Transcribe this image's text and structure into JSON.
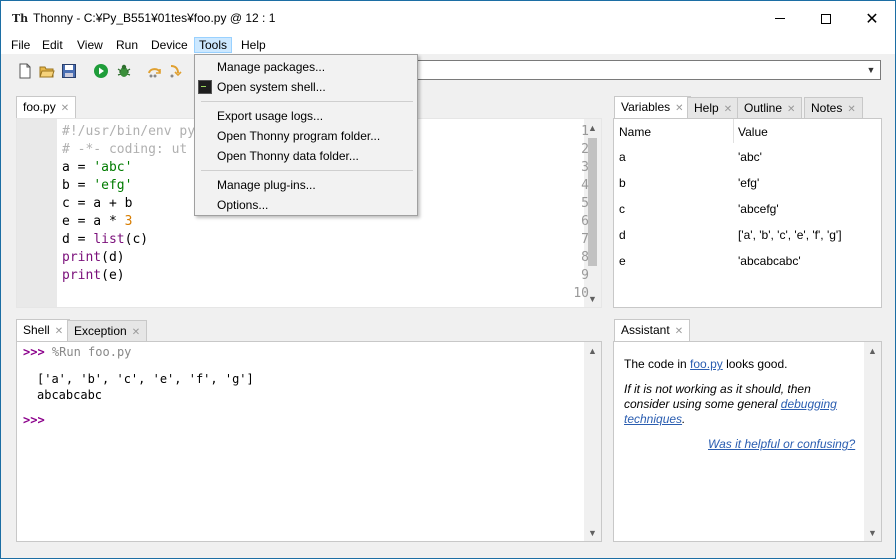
{
  "window": {
    "app_name": "Thonny",
    "path_title": "C:¥Py_B551¥01tes¥foo.py",
    "cursor": "@ 12 : 1",
    "icon_glyph": "Th"
  },
  "menubar": {
    "items": [
      "File",
      "Edit",
      "View",
      "Run",
      "Device",
      "Tools",
      "Help"
    ],
    "active": "Tools"
  },
  "toolbar": {
    "icons": [
      "new-file-icon",
      "open-file-icon",
      "save-icon",
      "run-icon",
      "debug-icon",
      "step-over-icon",
      "step-into-icon"
    ]
  },
  "tools_menu": {
    "items": [
      {
        "label": "Manage packages..."
      },
      {
        "label": "Open system shell..."
      },
      {
        "label": "Export usage logs..."
      },
      {
        "label": "Open Thonny program folder..."
      },
      {
        "label": "Open Thonny data folder..."
      },
      {
        "label": "Manage plug-ins..."
      },
      {
        "label": "Options..."
      }
    ]
  },
  "editor": {
    "tab": "foo.py",
    "line_numbers": [
      "1",
      "2",
      "3",
      "4",
      "5",
      "6",
      "7",
      "8",
      "9",
      "10"
    ],
    "lines": [
      {
        "parts": [
          {
            "t": "#!/usr/bin/env py",
            "c": "comment"
          }
        ]
      },
      {
        "parts": [
          {
            "t": "# -*- coding: ut",
            "c": "comment"
          }
        ]
      },
      {
        "parts": [
          {
            "t": "a = ",
            "c": ""
          },
          {
            "t": "'abc'",
            "c": "str"
          }
        ]
      },
      {
        "parts": [
          {
            "t": "b = ",
            "c": ""
          },
          {
            "t": "'efg'",
            "c": "str"
          }
        ]
      },
      {
        "parts": [
          {
            "t": "c = a + b",
            "c": ""
          }
        ]
      },
      {
        "parts": [
          {
            "t": "e = a * ",
            "c": ""
          },
          {
            "t": "3",
            "c": "num"
          }
        ]
      },
      {
        "parts": [
          {
            "t": "d = ",
            "c": ""
          },
          {
            "t": "list",
            "c": "kw"
          },
          {
            "t": "(c)",
            "c": ""
          }
        ]
      },
      {
        "parts": [
          {
            "t": "print",
            "c": "kw"
          },
          {
            "t": "(d)",
            "c": ""
          }
        ]
      },
      {
        "parts": [
          {
            "t": "print",
            "c": "kw"
          },
          {
            "t": "(e)",
            "c": ""
          }
        ]
      },
      {
        "parts": []
      }
    ]
  },
  "variables": {
    "tabs": [
      "Variables",
      "Help",
      "Outline",
      "Notes"
    ],
    "headers": [
      "Name",
      "Value"
    ],
    "rows": [
      {
        "name": "a",
        "value": "'abc'"
      },
      {
        "name": "b",
        "value": "'efg'"
      },
      {
        "name": "c",
        "value": "'abcefg'"
      },
      {
        "name": "d",
        "value": "['a', 'b', 'c', 'e', 'f', 'g']"
      },
      {
        "name": "e",
        "value": "'abcabcabc'"
      }
    ]
  },
  "shell": {
    "tabs": [
      "Shell",
      "Exception"
    ],
    "prompt": ">>>",
    "command": "%Run foo.py",
    "output": [
      "['a', 'b', 'c', 'e', 'f', 'g']",
      "abcabcabc"
    ]
  },
  "assistant": {
    "tab": "Assistant",
    "good_prefix": "The code in ",
    "good_link": "foo.py",
    "good_suffix": " looks good.",
    "hint_line1": "If it is not working as it should, then",
    "hint_line2": "consider using some general ",
    "hint_link1": "debugging",
    "hint_link2": "techniques",
    "hint_end": ".",
    "feedback_link": "Was it helpful or confusing?"
  },
  "colors": {
    "string": "#007b00",
    "number": "#d77d00",
    "keyword": "#7a0f7a",
    "comment": "#b0b0b0",
    "prompt": "#8b008b",
    "link": "#2a5db0"
  }
}
